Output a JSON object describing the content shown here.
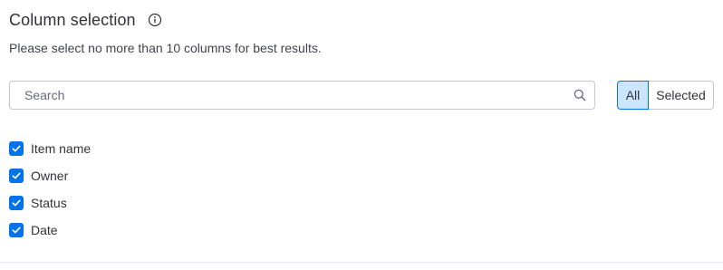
{
  "header": {
    "title": "Column selection",
    "info_icon": "info-icon"
  },
  "subtitle": "Please select no more than 10 columns for best results.",
  "search": {
    "placeholder": "Search",
    "value": "",
    "icon": "search-icon"
  },
  "filter_toggle": {
    "all_label": "All",
    "selected_label": "Selected",
    "active": "All"
  },
  "columns": [
    {
      "label": "Item name",
      "checked": true
    },
    {
      "label": "Owner",
      "checked": true
    },
    {
      "label": "Status",
      "checked": true
    },
    {
      "label": "Date",
      "checked": true
    }
  ],
  "colors": {
    "accent": "#0073ea",
    "toggle_active_bg": "#cce5ff",
    "text": "#323338",
    "border": "#c3c6d4"
  }
}
